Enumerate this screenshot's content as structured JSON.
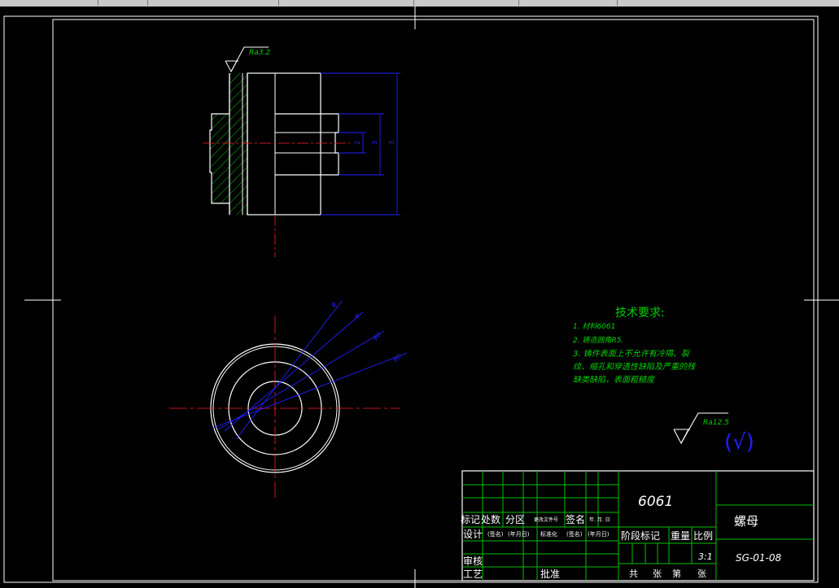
{
  "surface_finish": {
    "top_left": "Ra3.2",
    "general_value": "Ra12.5",
    "general_bracket": "(√)"
  },
  "dimensions": {
    "side_small": "2",
    "side_mid": "3",
    "side_large": "3",
    "dia_1": "φ",
    "dia_2": "φ",
    "dia_3": "φ0",
    "dia_4": "φ0"
  },
  "tech_requirements": {
    "title": "技术要求:",
    "lines": [
      "1. 材料6061",
      "2. 铸造圆角R5.",
      "3. 铸件表面上不允许有冷隔、裂",
      "纹、缩孔和穿透性缺陷及严重的残",
      "缺类缺陷，表面粗糙度"
    ]
  },
  "title_block": {
    "material": "6061",
    "part_name": "螺母",
    "drawing_no": "SG-01-08",
    "scale": "3:1",
    "row_labels": {
      "mark": "标记",
      "count": "处数",
      "zone": "分区",
      "change_doc": "更改文件号",
      "sign": "签名",
      "date": "年. 月. 日",
      "design": "设计",
      "sign_paren": "(签名)",
      "date_paren": "(年月日)",
      "standardize": "标准化",
      "sign_paren2": "(签名)",
      "date_paren2": "(年月日)",
      "review": "审核",
      "process": "工艺",
      "approve": "批准",
      "stage_mark": "阶段标记",
      "weight": "重量",
      "ratio": "比例",
      "total": "共",
      "sheets": "张",
      "number": "第",
      "sheets2": "张"
    }
  },
  "colors": {
    "outline": "#ffffff",
    "frame": "#ffffff",
    "dimension": "#2020ff",
    "hatch": "#00c000",
    "centerline": "#ff2020",
    "table_grid": "#00c000",
    "text_green": "#00d000",
    "text_white": "#ffffff",
    "background": "#000000",
    "toolbar": "#c9c9c9"
  }
}
